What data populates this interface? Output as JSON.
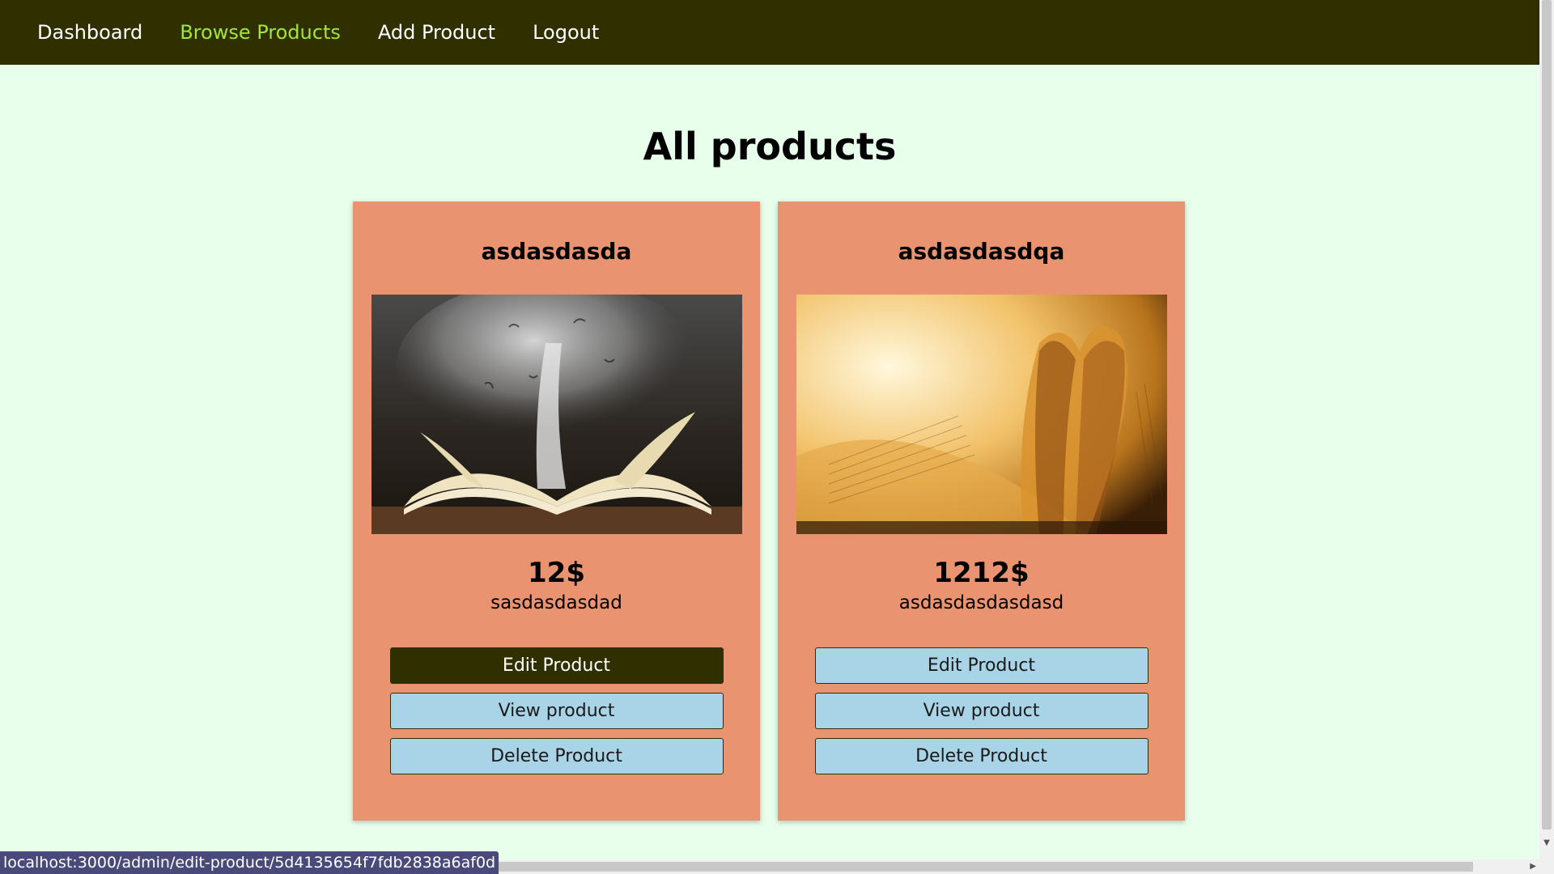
{
  "nav": {
    "items": [
      {
        "label": "Dashboard",
        "active": false
      },
      {
        "label": "Browse Products",
        "active": true
      },
      {
        "label": "Add Product",
        "active": false
      },
      {
        "label": "Logout",
        "active": false
      }
    ],
    "active_color": "#a3e635",
    "background": "#2f2f00"
  },
  "page": {
    "title": "All products",
    "background": "#e8ffec"
  },
  "products": [
    {
      "title": "asdasdasda",
      "price": "12$",
      "description": "sasdasdasdad",
      "image_icon": "book-tornado-image",
      "edit_label": "Edit Product",
      "view_label": "View product",
      "delete_label": "Delete Product"
    },
    {
      "title": "asdasdasdqa",
      "price": "1212$",
      "description": "asdasdasdasdasd",
      "image_icon": "book-heart-pages-image",
      "edit_label": "Edit Product",
      "view_label": "View product",
      "delete_label": "Delete Product"
    }
  ],
  "colors": {
    "card": "#e99371",
    "button": "#a9d3e6",
    "button_hover": "#2f2f00"
  },
  "status_bar": {
    "url": "localhost:3000/admin/edit-product/5d4135654f7fdb2838a6af0d"
  }
}
